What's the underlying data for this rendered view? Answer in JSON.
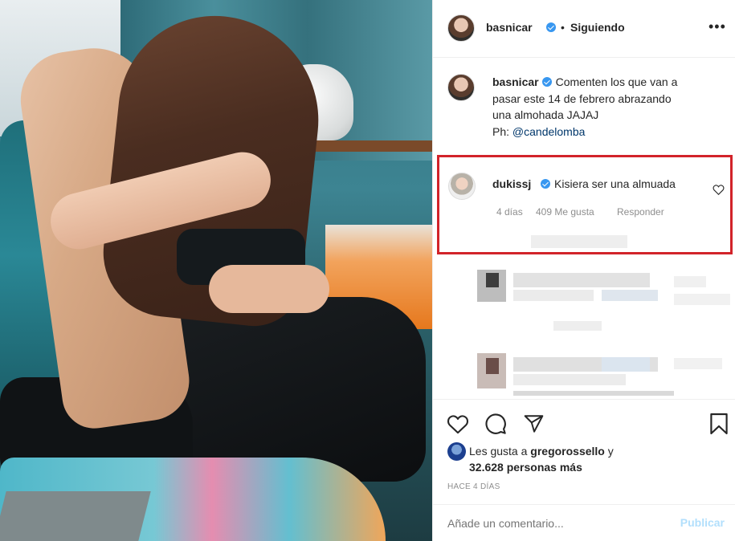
{
  "post": {
    "author": "basnicar",
    "separator": "•",
    "follow_status": "Siguiendo",
    "more_menu": "•••",
    "caption_line_1": "Comenten los que van a",
    "caption_line_2": "pasar este 14 de febrero abrazando",
    "caption_line_3": "una almohada JAJAJ",
    "caption_prefix": "Ph:",
    "caption_tag": "@candelomba"
  },
  "highlight_comment": {
    "author": "dukissj",
    "text": "Kisiera ser una almuada",
    "age": "4 días",
    "likes": "409 Me gusta",
    "reply": "Responder"
  },
  "likes": {
    "prefix": "Les gusta a",
    "user": "gregorossello",
    "suffix": "y",
    "count": "32.628 personas más"
  },
  "date": "HACE 4 DÍAS",
  "add_comment": {
    "placeholder": "Añade un comentario...",
    "publish": "Publicar"
  },
  "icons": {
    "like": "heart-icon",
    "comment": "comment-bubble-icon",
    "share": "paper-plane-icon",
    "save": "bookmark-icon",
    "verified": "verified-badge-icon",
    "comment_like": "heart-outline-icon"
  },
  "colors": {
    "highlight_border": "#d2232a",
    "verified": "#3897f0",
    "publish_disabled": "#b2dffc",
    "link": "#00376b",
    "secondary_text": "#8e8e8e"
  }
}
